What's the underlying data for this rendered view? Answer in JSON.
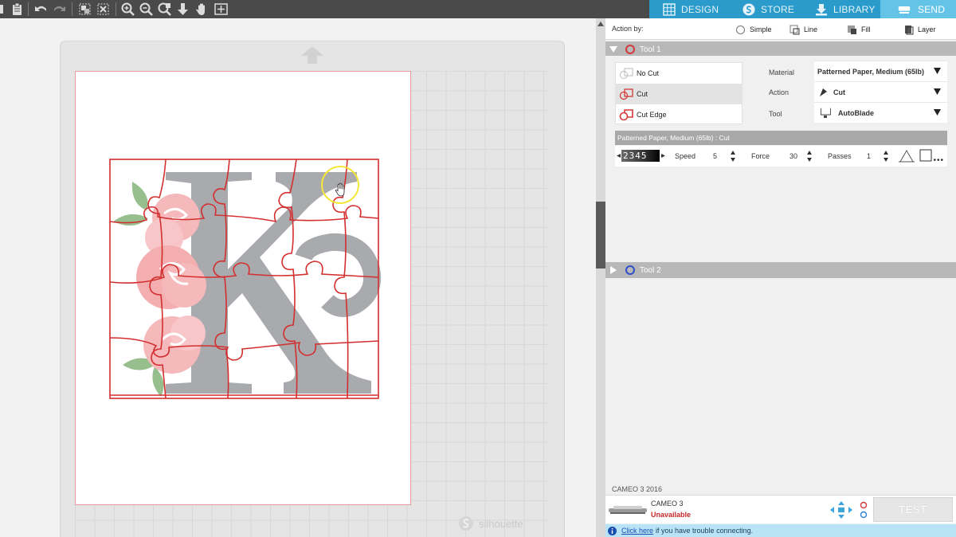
{
  "tabs": {
    "design": "DESIGN",
    "store": "STORE",
    "library": "LIBRARY",
    "send": "SEND"
  },
  "action_by": {
    "label": "Action by:",
    "options": [
      "Simple",
      "Line",
      "Fill",
      "Layer"
    ]
  },
  "tool1": {
    "title": "Tool 1",
    "cut_options": [
      "No Cut",
      "Cut",
      "Cut Edge"
    ],
    "selected_cut_option": "Cut",
    "material_label": "Material",
    "material_value": "Patterned Paper, Medium (65lb)",
    "action_label": "Action",
    "action_value": "Cut",
    "tool_label": "Tool",
    "tool_value": "AutoBlade",
    "summary": "Patterned Paper, Medium (65lb) : Cut",
    "blade_digits": "2345",
    "speed_label": "Speed",
    "speed_value": "5",
    "force_label": "Force",
    "force_value": "30",
    "passes_label": "Passes",
    "passes_value": "1"
  },
  "tool2": {
    "title": "Tool 2"
  },
  "device": {
    "section_label": "CAMEO 3 2016",
    "name": "CAMEO 3",
    "status": "Unavailable",
    "test_label": "TEST"
  },
  "help": {
    "link": "Click here",
    "text": "if you have trouble connecting."
  },
  "watermark": "silhouette",
  "colors": {
    "tab_blue": "#2b9bcc",
    "tab_active": "#64c4e8",
    "cut_line": "#d32f2f",
    "letter_gray": "#a9aaad",
    "rose_pink": "#f6b9bb",
    "leaf_green": "#97bf8e",
    "tool1_ring": "#d53a3a",
    "tool2_ring": "#2f4ec9",
    "status_red": "#c62828"
  }
}
